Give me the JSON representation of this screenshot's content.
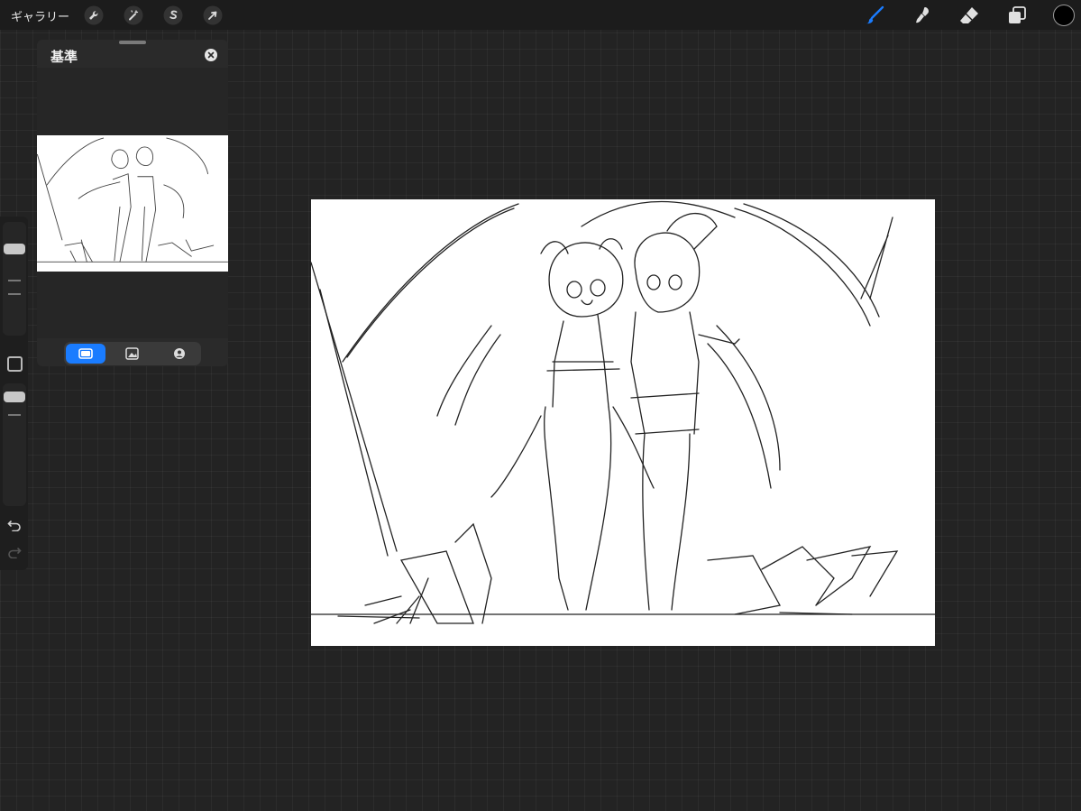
{
  "topbar": {
    "gallery_label": "ギャラリー",
    "left_tools": [
      {
        "name": "actions",
        "icon": "wrench-icon"
      },
      {
        "name": "adjustments",
        "icon": "magic-wand-icon"
      },
      {
        "name": "selection",
        "icon": "selection-s-icon"
      },
      {
        "name": "transform",
        "icon": "cursor-arrow-icon"
      }
    ],
    "right_tools": [
      {
        "name": "brush",
        "icon": "brush-icon",
        "active": true
      },
      {
        "name": "smudge",
        "icon": "smudge-finger-icon"
      },
      {
        "name": "eraser",
        "icon": "eraser-icon"
      },
      {
        "name": "layers",
        "icon": "layers-icon"
      }
    ],
    "current_color": "#000000",
    "accent_color": "#1a7cff"
  },
  "reference_panel": {
    "title": "基準",
    "tabs": [
      {
        "name": "canvas",
        "icon": "canvas-tab-icon",
        "active": true
      },
      {
        "name": "image",
        "icon": "image-tab-icon"
      },
      {
        "name": "face",
        "icon": "face-tab-icon"
      }
    ]
  },
  "sidebar": {
    "brush_size_icon": "size-slider",
    "opacity_icon": "opacity-slider",
    "undo_icon": "undo-icon",
    "redo_icon": "redo-icon"
  }
}
